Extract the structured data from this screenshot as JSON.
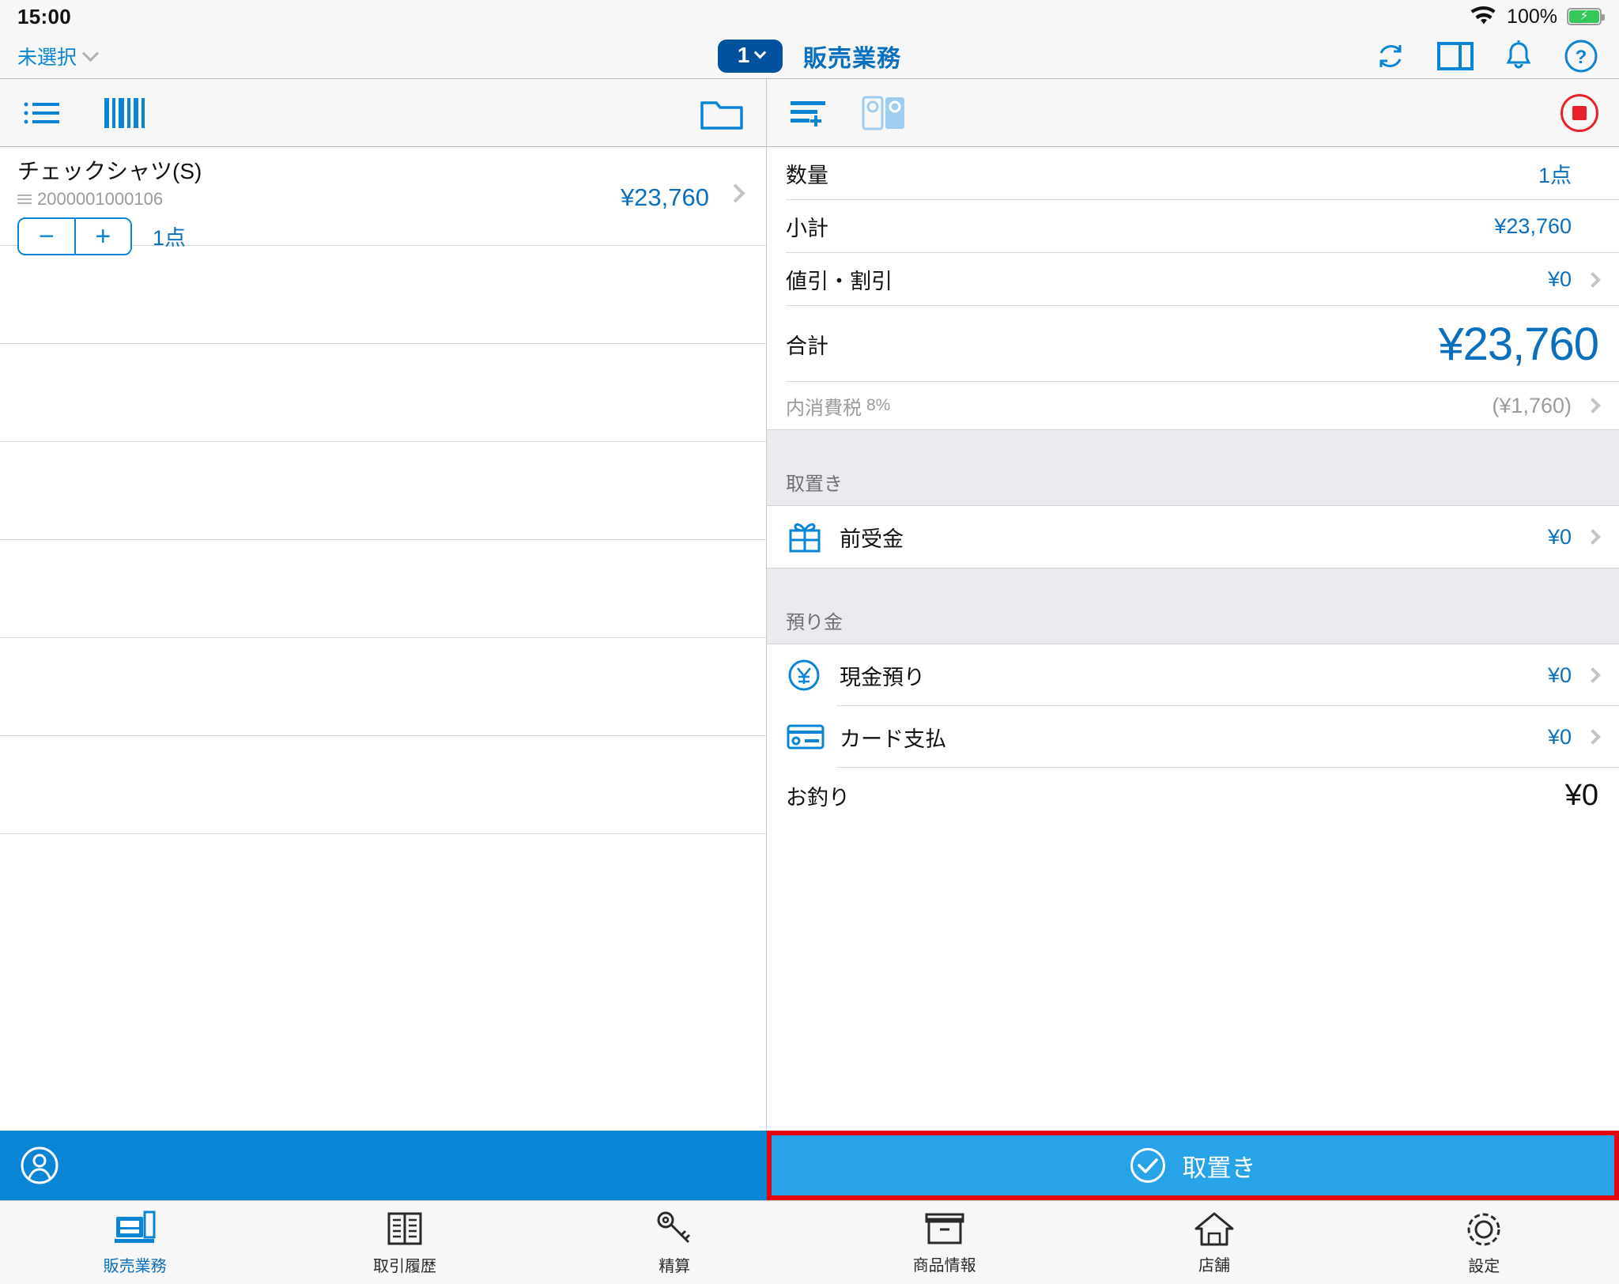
{
  "statusbar": {
    "time": "15:00",
    "battery_pct": "100%",
    "wifi_icon": "wifi-icon",
    "battery_icon": "battery-charging-icon"
  },
  "navbar": {
    "store_selector": "未選択",
    "register_number": "1",
    "title": "販売業務",
    "icons": [
      {
        "name": "refresh-icon",
        "label": "更新"
      },
      {
        "name": "split-view-icon",
        "label": "画面分割"
      },
      {
        "name": "bell-icon",
        "label": "通知"
      },
      {
        "name": "help-icon",
        "label": "ヘルプ"
      }
    ]
  },
  "left_toolbar": {
    "list_icon": "list-icon",
    "barcode_icon": "barcode-icon",
    "folder_icon": "folder-icon"
  },
  "cart": {
    "items": [
      {
        "name": "チェックシャツ(S)",
        "code": "2000001000106",
        "minus_label": "−",
        "plus_label": "+",
        "quantity": "1点",
        "price": "¥23,760"
      }
    ],
    "empty_rows": 6
  },
  "right_toolbar": {
    "add_list_icon": "add-list-icon",
    "receipt_toggle_icon": "receipt-toggle-icon",
    "stop_icon": "stop-icon"
  },
  "summary": {
    "rows": [
      {
        "label": "数量",
        "value": "1点",
        "arrow": false
      },
      {
        "label": "小計",
        "value": "¥23,760",
        "arrow": false
      },
      {
        "label": "値引・割引",
        "value": "¥0",
        "arrow": true
      }
    ],
    "total": {
      "label": "合計",
      "value": "¥23,760"
    },
    "tax": {
      "label": "内消費税",
      "rate": "8%",
      "value": "(¥1,760)",
      "arrow": true
    }
  },
  "layaway_section": {
    "header": "取置き",
    "rows": [
      {
        "icon": "gift-icon",
        "label": "前受金",
        "value": "¥0",
        "arrow": true
      }
    ]
  },
  "deposit_section": {
    "header": "預り金",
    "rows": [
      {
        "icon": "yen-circle-icon",
        "label": "現金預り",
        "value": "¥0",
        "arrow": true
      },
      {
        "icon": "credit-card-icon",
        "label": "カード支払",
        "value": "¥0",
        "arrow": true
      }
    ],
    "change": {
      "label": "お釣り",
      "value": "¥0"
    }
  },
  "actionbar": {
    "customer_icon": "customer-icon",
    "primary_label": "取置き",
    "primary_icon": "check-circle-icon"
  },
  "tabbar": {
    "tabs": [
      {
        "label": "販売業務",
        "icon": "register-icon",
        "active": true
      },
      {
        "label": "取引履歴",
        "icon": "history-icon",
        "active": false
      },
      {
        "label": "精算",
        "icon": "settlement-icon",
        "active": false
      },
      {
        "label": "商品情報",
        "icon": "product-icon",
        "active": false
      },
      {
        "label": "店舗",
        "icon": "store-icon",
        "active": false
      },
      {
        "label": "設定",
        "icon": "settings-icon",
        "active": false
      }
    ]
  },
  "colors": {
    "accent_blue": "#0a84d4",
    "title_blue": "#0a6fbd",
    "badge_blue": "#00519e",
    "highlight_red": "#e4000f",
    "action_blue": "#29a3e8",
    "battery_green": "#34c759"
  }
}
